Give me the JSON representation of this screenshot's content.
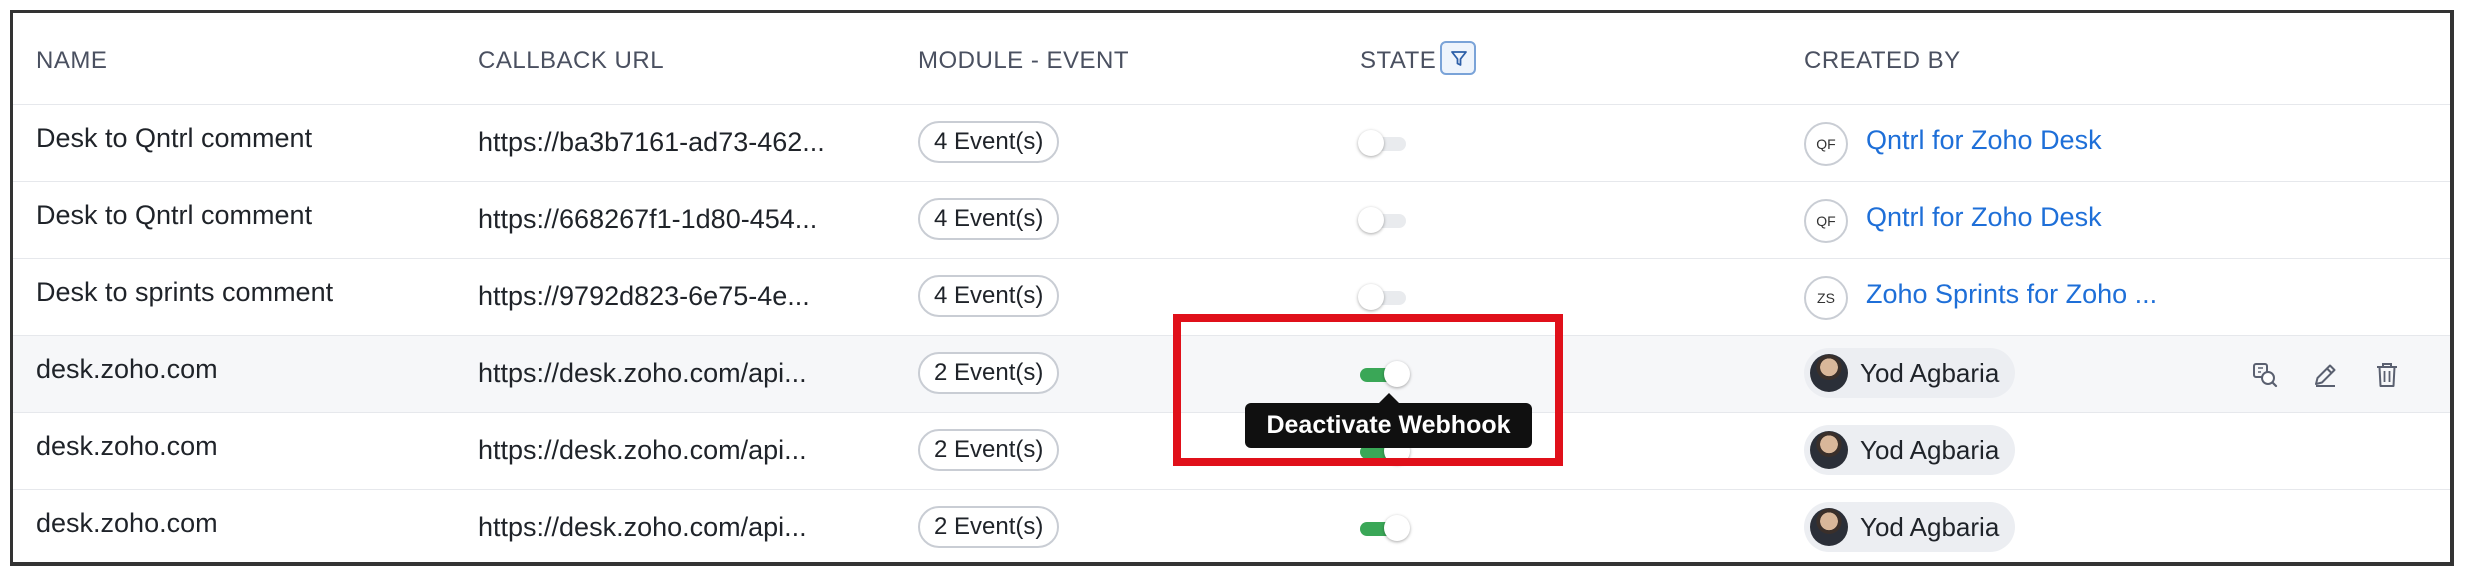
{
  "table": {
    "headers": {
      "name": "NAME",
      "callback_url": "CALLBACK URL",
      "module_event": "MODULE - EVENT",
      "state": "STATE",
      "created_by": "CREATED BY"
    },
    "rows": [
      {
        "name": "Desk to Qntrl comment",
        "url": "https://ba3b7161-ad73-462...",
        "events": "4 Event(s)",
        "state": "off",
        "creator_initials": "QF",
        "creator": "Qntrl for Zoho Desk"
      },
      {
        "name": "Desk to Qntrl comment",
        "url": "https://668267f1-1d80-454...",
        "events": "4 Event(s)",
        "state": "off",
        "creator_initials": "QF",
        "creator": "Qntrl for Zoho Desk"
      },
      {
        "name": "Desk to sprints comment",
        "url": "https://9792d823-6e75-4e...",
        "events": "4 Event(s)",
        "state": "off",
        "creator_initials": "ZS",
        "creator": "Zoho Sprints for Zoho ..."
      },
      {
        "name": "desk.zoho.com",
        "url": "https://desk.zoho.com/api...",
        "events": "2 Event(s)",
        "state": "on",
        "creator": "Yod Agbaria"
      },
      {
        "name": "desk.zoho.com",
        "url": "https://desk.zoho.com/api...",
        "events": "2 Event(s)",
        "state": "on",
        "creator": "Yod Agbaria"
      },
      {
        "name": "desk.zoho.com",
        "url": "https://desk.zoho.com/api...",
        "events": "2 Event(s)",
        "state": "on",
        "creator": "Yod Agbaria"
      }
    ]
  },
  "tooltip": {
    "text": "Deactivate Webhook"
  },
  "row_actions": [
    "test-webhook-icon",
    "edit-icon",
    "delete-icon"
  ],
  "colors": {
    "toggle_on": "#3aa757",
    "link": "#1e6fd8",
    "highlight": "#e0101a"
  }
}
